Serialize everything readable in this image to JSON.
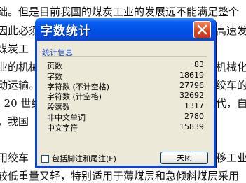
{
  "document": {
    "lines": [
      "础。但是目前我国的煤炭工业的发展远不能满足整个",
      "因此必须",
      "煤炭工",
      "业的机械",
      "动运输。",
      ". 20 世纪",
      "，我国",
      "用绞车",
      "较低重量又轻，特别适用于薄煤层和急倾斜煤层采用"
    ],
    "fragments": {
      "line2_right": "高速发",
      "line4_right": "机械化。",
      "line5_right": "绞车的",
      "line6_right": "代，自",
      "line8_right": "移工业"
    }
  },
  "dialog": {
    "title": "字数统计",
    "group_title": "统计信息",
    "stats": [
      {
        "label": "页数",
        "value": "83"
      },
      {
        "label": "字数",
        "value": "18619"
      },
      {
        "label": "字符数 (不计空格)",
        "value": "27796"
      },
      {
        "label": "字符数 (计空格)",
        "value": "32692"
      },
      {
        "label": "段落数",
        "value": "1317"
      },
      {
        "label": "非中文单词",
        "value": "2780"
      },
      {
        "label": "中文字符",
        "value": "15839"
      }
    ],
    "include_footnotes_label": "包括脚注和尾注(F)",
    "include_footnotes_checked": false,
    "close_label": "关闭",
    "close_icon": "close-icon"
  },
  "colors": {
    "title_bar": "#0054e3",
    "close_button": "#d9431c",
    "client_bg": "#ece9d8",
    "group_title": "#1c44c8"
  }
}
